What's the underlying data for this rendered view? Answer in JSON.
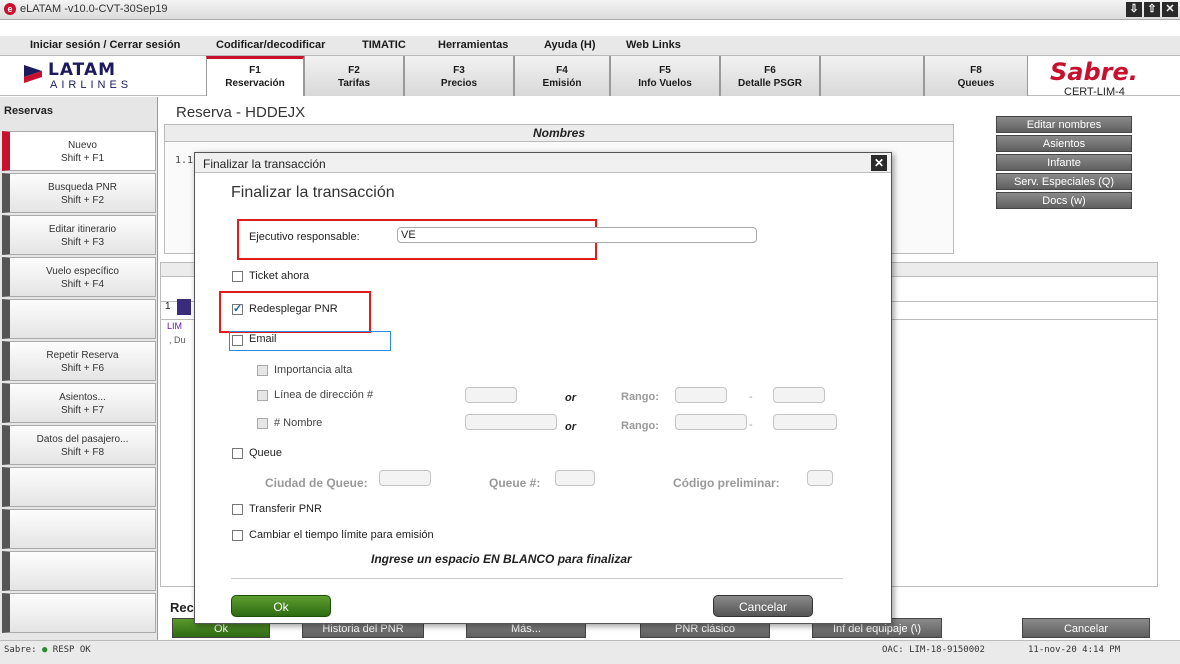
{
  "window": {
    "title": "eLATAM -v10.0-CVT-30Sep19",
    "app_icon_glyph": "e",
    "controls": [
      "⇩",
      "⇧",
      "✕"
    ]
  },
  "menu": {
    "items": [
      {
        "text": "Iniciar sesión / Cerrar sesión",
        "underline": "s"
      },
      {
        "text": "Codificar/decodificar"
      },
      {
        "text": "TIMATIC"
      },
      {
        "text": "Herramientas"
      },
      {
        "text": "Ayuda (H)"
      },
      {
        "text": "Web Links"
      }
    ]
  },
  "header": {
    "logo_main": "LATAM",
    "logo_sub": "AIRLINES",
    "fkeys": [
      {
        "key": "F1",
        "label": "Reservación",
        "active": true
      },
      {
        "key": "F2",
        "label": "Tarifas"
      },
      {
        "key": "F3",
        "label": "Precios"
      },
      {
        "key": "F4",
        "label": "Emisión"
      },
      {
        "key": "F5",
        "label": "Info Vuelos"
      },
      {
        "key": "F6",
        "label": "Detalle PSGR"
      },
      {
        "key": "",
        "label": ""
      },
      {
        "key": "F8",
        "label": "Queues"
      }
    ],
    "sabre_logo": "Sabre.",
    "cert_label": "CERT-LIM-4"
  },
  "sidebar": {
    "title": "Reservas",
    "items": [
      {
        "label": "Nuevo",
        "shortcut": "Shift + F1",
        "active": true
      },
      {
        "label": "Busqueda PNR",
        "shortcut": "Shift + F2"
      },
      {
        "label": "Editar itinerario",
        "shortcut": "Shift + F3"
      },
      {
        "label": "Vuelo específico",
        "shortcut": "Shift + F4"
      },
      {
        "label": "",
        "shortcut": ""
      },
      {
        "label": "Repetir Reserva",
        "shortcut": "Shift + F6"
      },
      {
        "label": "Asientos...",
        "shortcut": "Shift + F7"
      },
      {
        "label": "Datos del pasajero...",
        "shortcut": "Shift + F8"
      },
      {
        "label": "",
        "shortcut": ""
      },
      {
        "label": "",
        "shortcut": ""
      },
      {
        "label": "",
        "shortcut": ""
      },
      {
        "label": "",
        "shortcut": ""
      }
    ]
  },
  "main": {
    "title": "Reserva - HDDEJX",
    "names_header": "Nombres",
    "names_row": "1.1",
    "right_buttons": [
      "Editar nombres",
      "Asientos",
      "Infante",
      "Serv. Especiales (Q)",
      "Docs (w)"
    ],
    "itinerary": {
      "num": "1",
      "sub1": "LIM",
      "sub2": ", Du"
    },
    "bottom_title": "Rec",
    "bottom_buttons": [
      "Ok",
      "Historia del PNR",
      "Más...",
      "PNR clásico",
      "Inf del equipaje (\\)",
      "Cancelar"
    ]
  },
  "status": {
    "left_prefix": "Sabre:",
    "left_dot": "●",
    "left_text": "RESP OK",
    "oac": "OAC: LIM-18-9150002",
    "time": "11-nov-20 4:14 PM"
  },
  "modal": {
    "window_title": "Finalizar la transacción",
    "heading": "Finalizar la transacción",
    "close_glyph": "✕",
    "ejecutivo_label": "Ejecutivo responsable:",
    "ejecutivo_value": "VE",
    "ticket_ahora": "Ticket ahora",
    "redesplegar": "Redesplegar PNR",
    "email": "Email",
    "importancia": "Importancia alta",
    "linea": "Línea de dirección #",
    "nombre": "# Nombre",
    "or": "or",
    "rango": "Rango:",
    "dash": "-",
    "queue": "Queue",
    "ciudad_queue": "Ciudad de Queue:",
    "queue_num": "Queue #:",
    "codigo_prelim": "Código preliminar:",
    "transferir": "Transferir PNR",
    "cambiar": "Cambiar el tiempo límite para emisión",
    "info": "Ingrese un espacio EN BLANCO para finalizar",
    "ok": "Ok",
    "cancel": "Cancelar",
    "checks": {
      "ticket": false,
      "redesplegar": true,
      "email": false,
      "queue": false,
      "transferir": false,
      "cambiar": false
    }
  },
  "colors": {
    "brand_red": "#c8102e",
    "latam_navy": "#1b1b5e",
    "ok_green": "#2e6a14",
    "highlight_red": "#e21b1b",
    "highlight_blue": "#2a8adf"
  }
}
